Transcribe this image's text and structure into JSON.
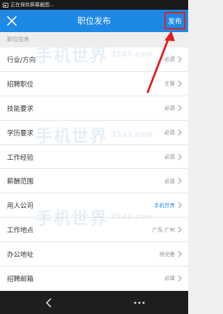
{
  "status_bar": {
    "text": "正在保存屏幕截图..."
  },
  "header": {
    "title": "职位发布",
    "publish_label": "发布"
  },
  "section": {
    "label": "职位信息"
  },
  "rows": [
    {
      "label": "行业/方向",
      "value": "必选"
    },
    {
      "label": "招聘职位",
      "value": "主管"
    },
    {
      "label": "技能要求",
      "value": "必选"
    },
    {
      "label": "学历要求",
      "value": "必选"
    },
    {
      "label": "工作经验",
      "value": "必选"
    },
    {
      "label": "薪酬范围",
      "value": "必选"
    },
    {
      "label": "用人公司",
      "value": "手机世界"
    },
    {
      "label": "工作地点",
      "value": "广东 广州"
    },
    {
      "label": "办公地址",
      "value": "待完善"
    },
    {
      "label": "招聘邮箱",
      "value": "必填"
    }
  ],
  "watermark": {
    "main": "手机世界",
    "sub": "3533.com"
  },
  "colors": {
    "header": "#1e88e5",
    "highlight_box": "#e02020",
    "accent_value": "#1e88e5"
  },
  "icons": [
    "screenshot-icon",
    "close-icon",
    "chevron-right-icon",
    "back-icon",
    "more-icon"
  ]
}
